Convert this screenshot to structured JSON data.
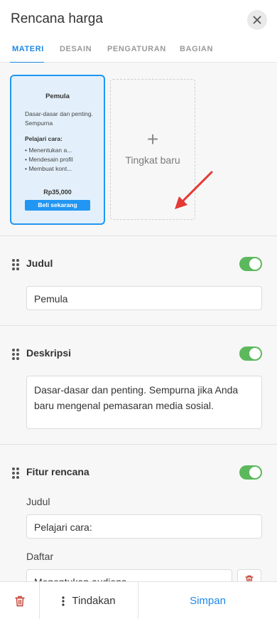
{
  "header": {
    "title": "Rencana harga",
    "close_icon": "close-icon"
  },
  "tabs": [
    {
      "label": "MATERI",
      "active": true
    },
    {
      "label": "DESAIN",
      "active": false
    },
    {
      "label": "PENGATURAN",
      "active": false
    },
    {
      "label": "BAGIAN",
      "active": false
    }
  ],
  "tier_card": {
    "name": "Pemula",
    "description": "Dasar-dasar dan penting. Sempurna",
    "features_title": "Pelajari cara:",
    "features": [
      "• Menentukan a...",
      "• Mendesain profil",
      "• Membuat kont..."
    ],
    "price": "Rp35,000",
    "button": "Beli sekarang"
  },
  "new_tier": {
    "plus": "+",
    "label": "Tingkat baru"
  },
  "sections": {
    "title": {
      "label": "Judul",
      "value": "Pemula",
      "enabled": true
    },
    "description": {
      "label": "Deskripsi",
      "value": "Dasar-dasar dan penting. Sempurna jika Anda baru mengenal pemasaran media sosial.",
      "enabled": true
    },
    "features": {
      "label": "Fitur rencana",
      "enabled": true,
      "title_label": "Judul",
      "title_value": "Pelajari cara:",
      "list_label": "Daftar",
      "list_first_item": "Menentukan audiens"
    }
  },
  "footer": {
    "actions_label": "Tindakan",
    "save_label": "Simpan"
  },
  "colors": {
    "accent": "#1e88e5",
    "toggle_on": "#5cb85c",
    "delete": "#c0392b",
    "arrow": "#e53935"
  }
}
